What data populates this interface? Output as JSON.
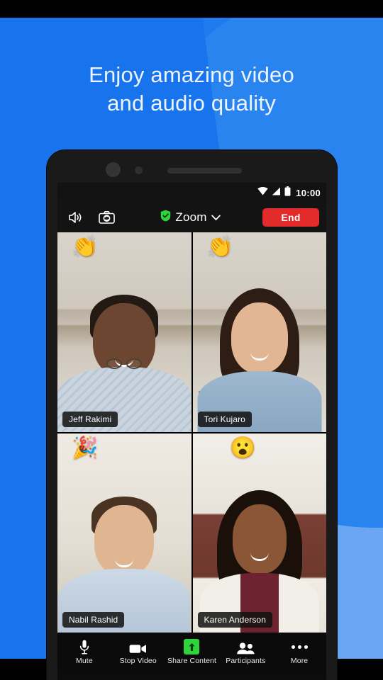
{
  "promo": {
    "headline_line1": "Enjoy amazing video",
    "headline_line2": "and audio quality",
    "bg_color": "#1f7bed",
    "bg_accent_color": "#6aa6f2"
  },
  "status_bar": {
    "time": "10:00",
    "wifi_icon": "wifi-icon",
    "signal_icon": "cellular-signal-icon",
    "battery_icon": "battery-icon"
  },
  "meeting_topbar": {
    "speaker_icon": "speaker-icon",
    "flip_camera_icon": "flip-camera-icon",
    "shield_icon": "shield-check-icon",
    "title": "Zoom",
    "chevron_icon": "chevron-down-icon",
    "end_label": "End",
    "end_color": "#e32b2b",
    "shield_color": "#2fd43a"
  },
  "video_grid": {
    "active_border_color": "#3ad62f",
    "tiles": [
      {
        "name": "Jeff Rakimi",
        "reaction": "👏",
        "reaction_name": "clapping-hands-emoji",
        "active_speaker": false
      },
      {
        "name": "Tori Kujaro",
        "reaction": "👏",
        "reaction_name": "clapping-hands-emoji",
        "active_speaker": true
      },
      {
        "name": "Nabil Rashid",
        "reaction": "🎉",
        "reaction_name": "party-popper-emoji",
        "active_speaker": false
      },
      {
        "name": "Karen Anderson",
        "reaction": "😮",
        "reaction_name": "open-mouth-face-emoji",
        "active_speaker": false
      }
    ]
  },
  "control_bar": {
    "items": [
      {
        "label": "Mute",
        "icon": "microphone-icon"
      },
      {
        "label": "Stop Video",
        "icon": "video-camera-icon"
      },
      {
        "label": "Share Content",
        "icon": "share-arrow-icon"
      },
      {
        "label": "Participants",
        "icon": "participants-icon"
      },
      {
        "label": "More",
        "icon": "more-dots-icon"
      }
    ],
    "share_accent_color": "#2fd43a"
  }
}
